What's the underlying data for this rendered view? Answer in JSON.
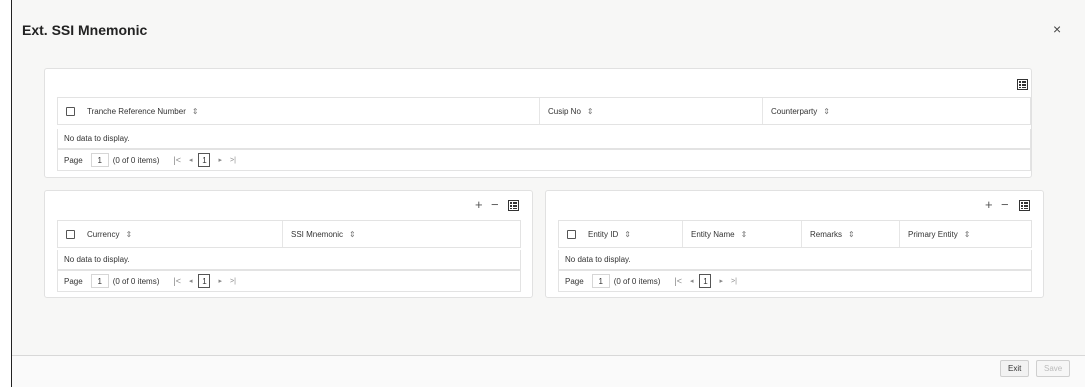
{
  "window": {
    "title": "Ext. SSI Mnemonic",
    "close_icon": "close-icon"
  },
  "tranche_grid": {
    "columns": [
      "Tranche Reference Number",
      "Cusip No",
      "Counterparty"
    ],
    "empty_text": "No data to display.",
    "pager": {
      "label": "Page",
      "page": "1",
      "items": "(0 of 0 items)",
      "current": "1"
    }
  },
  "currency_grid": {
    "columns": [
      "Currency",
      "SSI Mnemonic"
    ],
    "empty_text": "No data to display.",
    "pager": {
      "label": "Page",
      "page": "1",
      "items": "(0 of 0 items)",
      "current": "1"
    }
  },
  "entity_grid": {
    "columns": [
      "Entity ID",
      "Entity Name",
      "Remarks",
      "Primary Entity"
    ],
    "empty_text": "No data to display.",
    "pager": {
      "label": "Page",
      "page": "1",
      "items": "(0 of 0 items)",
      "current": "1"
    }
  },
  "footer": {
    "exit_label": "Exit",
    "save_label": "Save"
  },
  "symbols": {
    "sort": "⇕",
    "first": "|<",
    "prev": "◂",
    "next": "▸",
    "last": ">|",
    "add": "+",
    "remove": "−",
    "close": "×"
  }
}
